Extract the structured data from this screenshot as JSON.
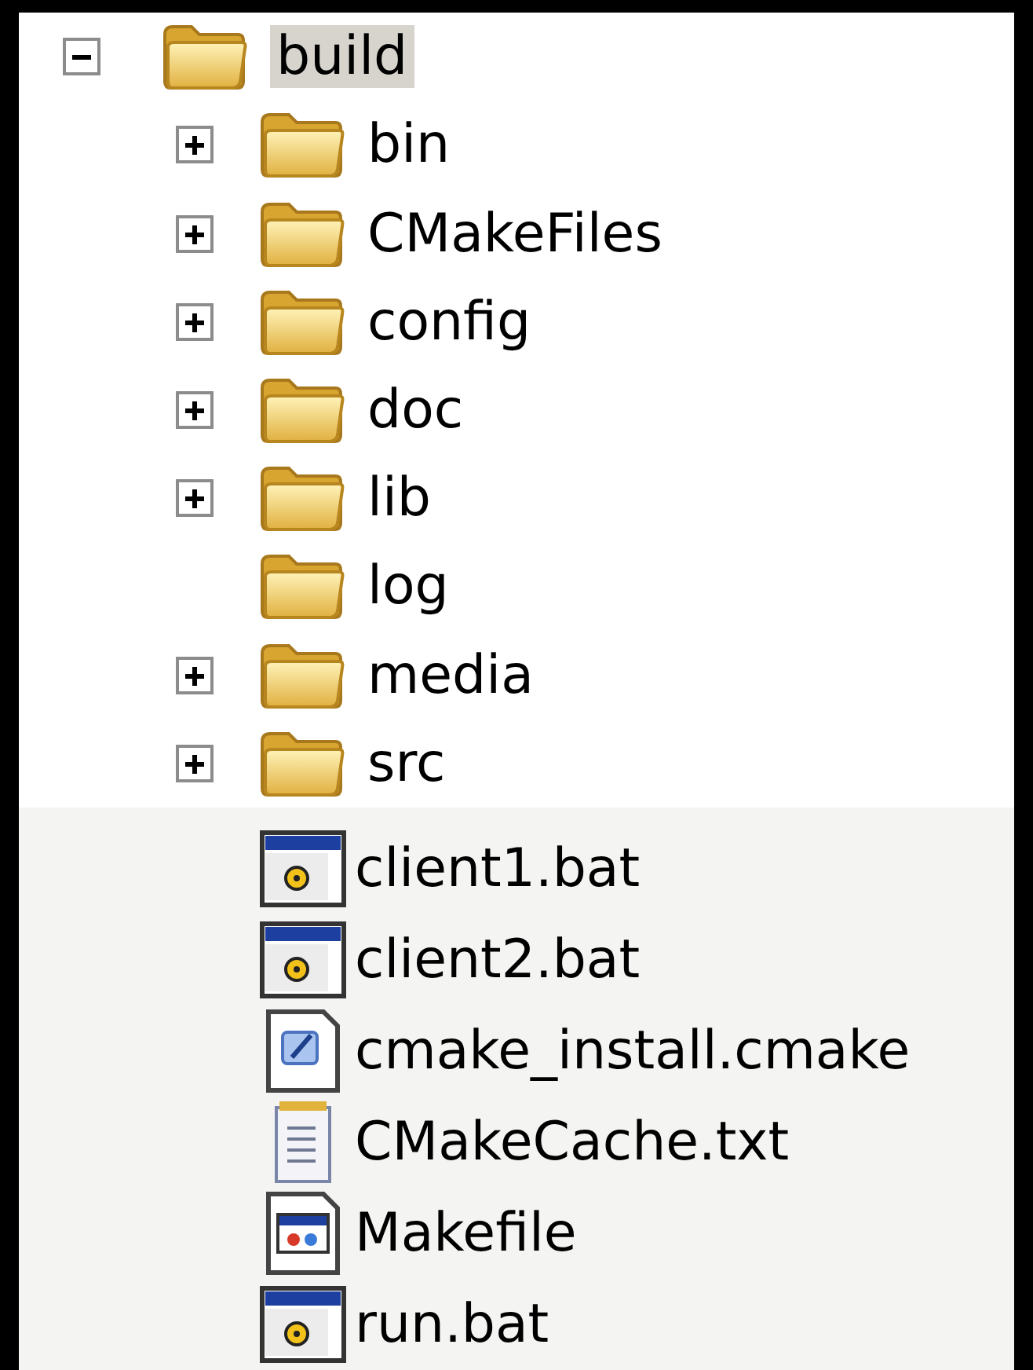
{
  "tree": {
    "name": "build",
    "expanded": true,
    "selected": true,
    "children": [
      {
        "name": "bin",
        "kind": "folder",
        "expanded": false,
        "selected": false
      },
      {
        "name": "CMakeFiles",
        "kind": "folder",
        "expanded": false,
        "selected": false
      },
      {
        "name": "config",
        "kind": "folder",
        "expanded": false,
        "selected": false
      },
      {
        "name": "doc",
        "kind": "folder",
        "expanded": false,
        "selected": false
      },
      {
        "name": "lib",
        "kind": "folder",
        "expanded": false,
        "selected": false
      },
      {
        "name": "log",
        "kind": "folder",
        "selected": false
      },
      {
        "name": "media",
        "kind": "folder",
        "expanded": false,
        "selected": false
      },
      {
        "name": "src",
        "kind": "folder",
        "expanded": false,
        "selected": false
      },
      {
        "name": "client1.bat",
        "kind": "batch",
        "selected": false
      },
      {
        "name": "client2.bat",
        "kind": "batch",
        "selected": false
      },
      {
        "name": "cmake_install.cmake",
        "kind": "script",
        "selected": false
      },
      {
        "name": "CMakeCache.txt",
        "kind": "text",
        "selected": false
      },
      {
        "name": "Makefile",
        "kind": "makefile",
        "selected": false
      },
      {
        "name": "run.bat",
        "kind": "batch",
        "selected": false
      }
    ]
  }
}
